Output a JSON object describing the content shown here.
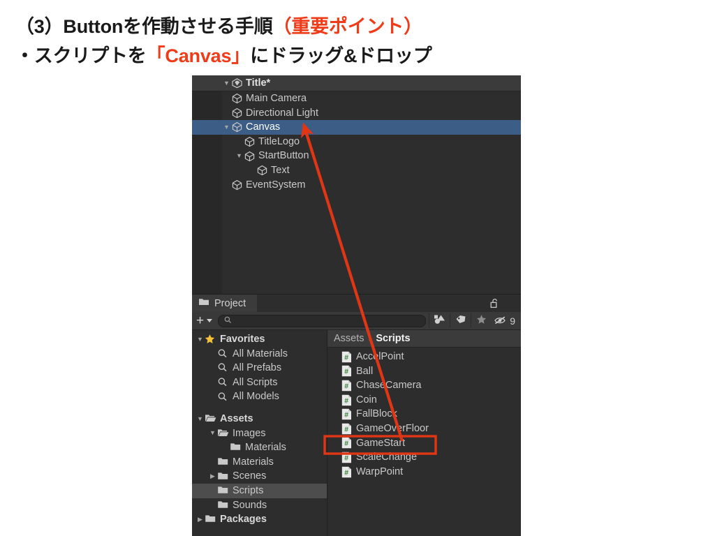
{
  "slide": {
    "heading_line1_prefix": "（3）Buttonを作動させる手順",
    "heading_line1_accent": "（重要ポイント）",
    "heading_line2_prefix": "・スクリプトを",
    "heading_line2_accent": "「Canvas」",
    "heading_line2_suffix": "にドラッグ&ドロップ",
    "accent_color": "#ef3b18",
    "annotation_color": "#e03616"
  },
  "hierarchy": {
    "scene_name": "Title*",
    "scene_icon": "unity-scene-icon",
    "kebab_icon": "kebab-menu-icon",
    "rows": [
      {
        "label": "Main Camera",
        "indent": 1,
        "foldout": "none",
        "selected": false
      },
      {
        "label": "Directional Light",
        "indent": 1,
        "foldout": "none",
        "selected": false
      },
      {
        "label": "Canvas",
        "indent": 1,
        "foldout": "open",
        "selected": true
      },
      {
        "label": "TitleLogo",
        "indent": 2,
        "foldout": "none",
        "selected": false
      },
      {
        "label": "StartButton",
        "indent": 2,
        "foldout": "open",
        "selected": false
      },
      {
        "label": "Text",
        "indent": 3,
        "foldout": "none",
        "selected": false
      },
      {
        "label": "EventSystem",
        "indent": 1,
        "foldout": "none",
        "selected": false
      }
    ]
  },
  "project": {
    "tab_label": "Project",
    "tab_icon": "folder-icon",
    "lock_icon": "padlock-open-icon",
    "kebab_icon": "kebab-menu-icon",
    "toolbar": {
      "add_label": "+",
      "add_icon": "plus-icon",
      "dropdown_icon": "chevron-down-icon",
      "search_placeholder": "",
      "search_value": "",
      "search_icon": "magnifier-icon",
      "filter_type_icon": "filter-by-type-icon",
      "filter_label_icon": "tag-icon",
      "filter_favorite_icon": "star-icon",
      "hidden_packages_icon": "eye-crossed-icon",
      "hidden_packages_count": "9"
    },
    "tree": [
      {
        "label": "Favorites",
        "indent": 0,
        "foldout": "open",
        "icon": "star-icon",
        "bold": true,
        "selected": false
      },
      {
        "label": "All Materials",
        "indent": 1,
        "foldout": "none",
        "icon": "magnifier-icon",
        "bold": false,
        "selected": false
      },
      {
        "label": "All Prefabs",
        "indent": 1,
        "foldout": "none",
        "icon": "magnifier-icon",
        "bold": false,
        "selected": false
      },
      {
        "label": "All Scripts",
        "indent": 1,
        "foldout": "none",
        "icon": "magnifier-icon",
        "bold": false,
        "selected": false
      },
      {
        "label": "All Models",
        "indent": 1,
        "foldout": "none",
        "icon": "magnifier-icon",
        "bold": false,
        "selected": false
      },
      {
        "label": "",
        "indent": 0,
        "foldout": "spacer",
        "icon": "",
        "bold": false,
        "selected": false
      },
      {
        "label": "Assets",
        "indent": 0,
        "foldout": "open",
        "icon": "folder-open-icon",
        "bold": true,
        "selected": false
      },
      {
        "label": "Images",
        "indent": 1,
        "foldout": "open",
        "icon": "folder-open-icon",
        "bold": false,
        "selected": false
      },
      {
        "label": "Materials",
        "indent": 2,
        "foldout": "none",
        "icon": "folder-icon",
        "bold": false,
        "selected": false
      },
      {
        "label": "Materials",
        "indent": 1,
        "foldout": "none",
        "icon": "folder-icon",
        "bold": false,
        "selected": false
      },
      {
        "label": "Scenes",
        "indent": 1,
        "foldout": "closed",
        "icon": "folder-icon",
        "bold": false,
        "selected": false
      },
      {
        "label": "Scripts",
        "indent": 1,
        "foldout": "none",
        "icon": "folder-icon",
        "bold": false,
        "selected": true
      },
      {
        "label": "Sounds",
        "indent": 1,
        "foldout": "none",
        "icon": "folder-icon",
        "bold": false,
        "selected": false
      },
      {
        "label": "Packages",
        "indent": 0,
        "foldout": "closed",
        "icon": "folder-icon",
        "bold": true,
        "selected": false
      }
    ],
    "breadcrumb": {
      "root": "Assets",
      "separator": "›",
      "current": "Scripts"
    },
    "assets": [
      {
        "name": "AccelPoint",
        "icon": "csharp-script-icon",
        "highlighted": false
      },
      {
        "name": "Ball",
        "icon": "csharp-script-icon",
        "highlighted": false
      },
      {
        "name": "ChaseCamera",
        "icon": "csharp-script-icon",
        "highlighted": false
      },
      {
        "name": "Coin",
        "icon": "csharp-script-icon",
        "highlighted": false
      },
      {
        "name": "FallBlock",
        "icon": "csharp-script-icon",
        "highlighted": false
      },
      {
        "name": "GameOverFloor",
        "icon": "csharp-script-icon",
        "highlighted": false
      },
      {
        "name": "GameStart",
        "icon": "csharp-script-icon",
        "highlighted": true
      },
      {
        "name": "ScaleChange",
        "icon": "csharp-script-icon",
        "highlighted": false
      },
      {
        "name": "WarpPoint",
        "icon": "csharp-script-icon",
        "highlighted": false
      }
    ]
  },
  "annotations": {
    "drag_arrow_name": "drag-drop-arrow",
    "highlight_box_name": "gamestart-highlight-box"
  }
}
